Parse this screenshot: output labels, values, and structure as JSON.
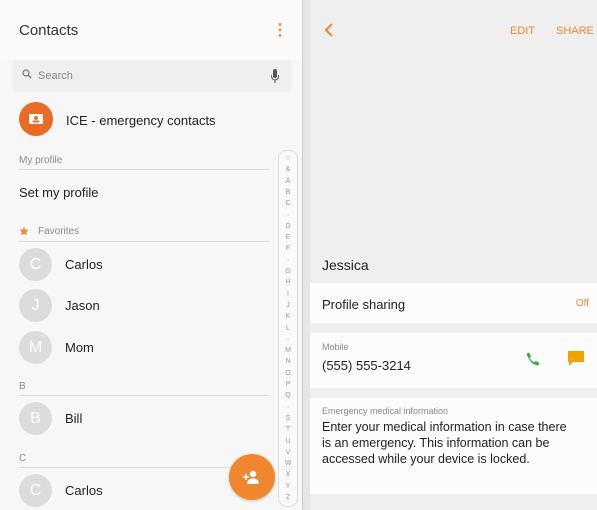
{
  "left": {
    "title": "Contacts",
    "menu_icon": "more-vert-icon",
    "search": {
      "placeholder": "Search",
      "icon": "search-icon",
      "voice_icon": "mic-icon"
    },
    "ice": {
      "label": "ICE - emergency contacts",
      "icon": "ice-id-card-icon",
      "color": "#ea6a26"
    },
    "my_profile": {
      "header": "My profile",
      "label": "Set my profile"
    },
    "favorites": {
      "header": "Favorites",
      "icon": "star-icon",
      "contacts": [
        {
          "initial": "C",
          "name": "Carlos"
        },
        {
          "initial": "J",
          "name": "Jason"
        },
        {
          "initial": "M",
          "name": "Mom"
        }
      ]
    },
    "sections": [
      {
        "header": "B",
        "contacts": [
          {
            "initial": "B",
            "name": "Bill"
          }
        ]
      },
      {
        "header": "C",
        "contacts": [
          {
            "initial": "C",
            "name": "Carlos"
          }
        ]
      }
    ],
    "index_letters": [
      "☆",
      "&",
      "A",
      "B",
      "C",
      "·",
      "D",
      "E",
      "F",
      "·",
      "G",
      "H",
      "I",
      "J",
      "K",
      "L",
      "·",
      "M",
      "N",
      "O",
      "P",
      "Q",
      "·",
      "S",
      "T",
      "U",
      "V",
      "W",
      "X",
      "Y",
      "Z"
    ],
    "fab_icon": "add-contact-icon",
    "accent": "#f0872f"
  },
  "right": {
    "back_icon": "back-arrow-icon",
    "edit": "EDIT",
    "share": "SHARE",
    "name": "Jessica",
    "profile_sharing": {
      "label": "Profile sharing",
      "value": "Off"
    },
    "mobile": {
      "label": "Mobile",
      "number": "(555) 555-3214",
      "call_icon": "phone-icon",
      "message_icon": "message-icon",
      "call_color": "#3aa845",
      "message_color": "#f2a100"
    },
    "emergency": {
      "label": "Emergency medical information",
      "text": "Enter your medical information in case there is an emergency. This information can be accessed while your device is locked."
    }
  }
}
